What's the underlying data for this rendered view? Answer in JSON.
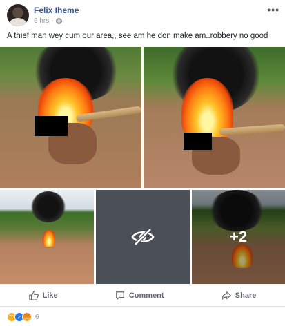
{
  "post": {
    "author": "Felix Iheme",
    "time": "6 hrs",
    "separator": "·",
    "more": "•••",
    "caption": "A thief man wey cum our area,, see am he don make am..robbery no good"
  },
  "photos": {
    "extra_count": "+2"
  },
  "actions": {
    "like": "Like",
    "comment": "Comment",
    "share": "Share"
  },
  "reactions": {
    "count": "6",
    "types": [
      "sad-reaction-icon",
      "like-reaction-icon",
      "angry-reaction-icon"
    ]
  }
}
